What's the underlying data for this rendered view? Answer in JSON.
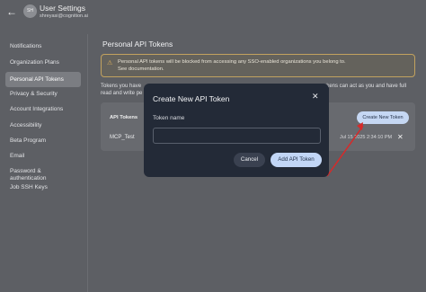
{
  "header": {
    "back_icon": "arrow-left-icon",
    "avatar_initials": "SH",
    "title": "User Settings",
    "email": "shreyasi@cognition.ai"
  },
  "sidebar": {
    "items": [
      {
        "label": "Notifications"
      },
      {
        "label": "Organization Plans"
      },
      {
        "label": "Personal API Tokens",
        "active": true
      },
      {
        "label": "Privacy & Security"
      },
      {
        "label": "Account Integrations"
      },
      {
        "label": "Accessibility"
      },
      {
        "label": "Beta Program"
      },
      {
        "label": "Email"
      },
      {
        "label": "Password & authentication"
      },
      {
        "label": "Job SSH Keys"
      }
    ]
  },
  "main": {
    "section_title": "Personal API Tokens",
    "warning": {
      "icon": "warning-icon",
      "line1": "Personal API tokens will be blocked from accessing any SSO-enabled organizations you belong to.",
      "line2": "See documentation."
    },
    "description": {
      "line1": "Tokens you have",
      "line2": "read and write pe",
      "line1_right": "okens can act as you and have full",
      "line2_right": ""
    },
    "tokens": {
      "column_header": "API Tokens",
      "create_label": "Create New Token",
      "rows": [
        {
          "name": "MCP_Test",
          "date": "Jul 15 2025 2:34:10 PM"
        }
      ]
    }
  },
  "modal": {
    "title": "Create New API Token",
    "field_label": "Token name",
    "field_value": "",
    "cancel_label": "Cancel",
    "submit_label": "Add API Token"
  },
  "colors": {
    "accent": "#c2d6f6",
    "warning_border": "#c2a25f",
    "annotation_arrow": "#d62a2a"
  }
}
